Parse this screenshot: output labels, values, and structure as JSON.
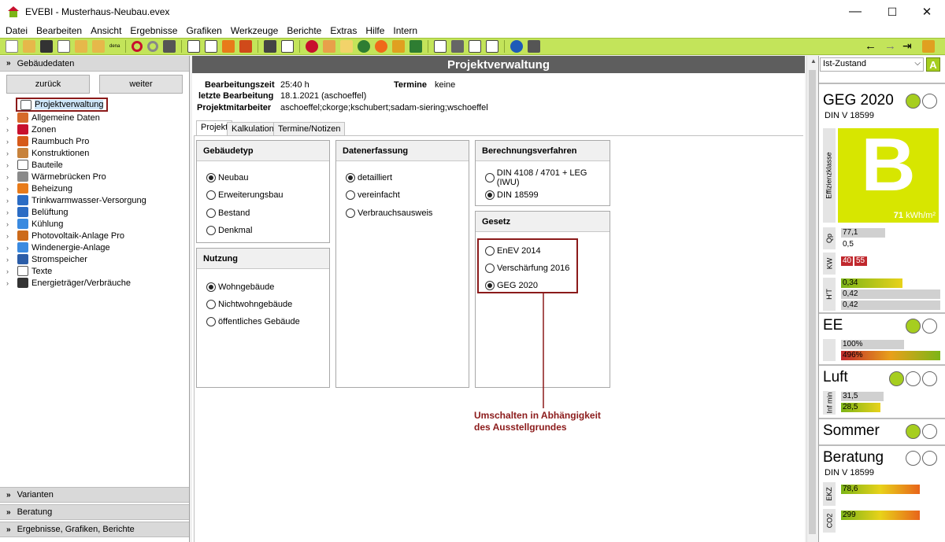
{
  "window": {
    "title": "EVEBI - Musterhaus-Neubau.evex",
    "minimize": "—",
    "maximize": "☐",
    "close": "✕"
  },
  "menu": [
    "Datei",
    "Bearbeiten",
    "Ansicht",
    "Ergebnisse",
    "Grafiken",
    "Werkzeuge",
    "Berichte",
    "Extras",
    "Hilfe",
    "Intern"
  ],
  "toolbar": {
    "dena_label": "dena",
    "icons": [
      "new-file-icon",
      "open-folder-icon",
      "save-icon",
      "copy-icon",
      "export-icon",
      "import-icon",
      "undo-icon",
      "redo-icon",
      "calculator-icon",
      "document-icon",
      "table-icon",
      "sum-icon",
      "book-icon",
      "structure-icon",
      "list-icon",
      "heating-icon",
      "wall-icon",
      "window-icon",
      "ventilation-icon",
      "sun-icon",
      "power-icon",
      "house-icon",
      "report-icon",
      "print-icon",
      "edit-icon",
      "chart-icon",
      "help-icon",
      "calculator-small-icon"
    ],
    "right_icons": [
      "back-arrow-icon",
      "forward-arrow-icon",
      "jump-icon",
      "pen-icon"
    ]
  },
  "left": {
    "header": "Gebäudedaten",
    "back": "zurück",
    "forward": "weiter",
    "tree": [
      {
        "label": "Projektverwaltung",
        "icon": "stopwatch-icon",
        "color": "#ffffff"
      },
      {
        "label": "Allgemeine Daten",
        "icon": "house-data-icon",
        "color": "#d66a2a"
      },
      {
        "label": "Zonen",
        "icon": "zones-icon",
        "color": "#c8102e"
      },
      {
        "label": "Raumbuch Pro",
        "icon": "roombook-icon",
        "color": "#d65a1a"
      },
      {
        "label": "Konstruktionen",
        "icon": "construction-icon",
        "color": "#c7823c"
      },
      {
        "label": "Bauteile",
        "icon": "building-part-icon",
        "color": "#ffffff"
      },
      {
        "label": "Wärmebrücken Pro",
        "icon": "thermal-bridge-icon",
        "color": "#8a8a8a"
      },
      {
        "label": "Beheizung",
        "icon": "heating-icon",
        "color": "#e87b1a"
      },
      {
        "label": "Trinkwarmwasser-Versorgung",
        "icon": "water-drop-icon",
        "color": "#2b6cc4"
      },
      {
        "label": "Belüftung",
        "icon": "fan-icon",
        "color": "#2b6cc4"
      },
      {
        "label": "Kühlung",
        "icon": "snowflake-icon",
        "color": "#3a8ae0"
      },
      {
        "label": "Photovoltaik-Anlage Pro",
        "icon": "solar-icon",
        "color": "#cc6a1a"
      },
      {
        "label": "Windenergie-Anlage",
        "icon": "wind-icon",
        "color": "#3a8ae0"
      },
      {
        "label": "Stromspeicher",
        "icon": "battery-icon",
        "color": "#2b5da8"
      },
      {
        "label": "Texte",
        "icon": "text-icon",
        "color": "#ffffff"
      },
      {
        "label": "Energieträger/Verbräuche",
        "icon": "plug-icon",
        "color": "#333333"
      }
    ],
    "sections": [
      "Varianten",
      "Beratung",
      "Ergebnisse, Grafiken, Berichte"
    ]
  },
  "center": {
    "title": "Projektverwaltung",
    "info": {
      "bearbeitungszeit_label": "Bearbeitungszeit",
      "bearbeitungszeit": "25:40 h",
      "termine_label": "Termine",
      "termine": "keine",
      "letzte_label": "letzte Bearbeitung",
      "letzte": "18.1.2021 (aschoeffel)",
      "mitarbeiter_label": "Projektmitarbeiter",
      "mitarbeiter": "aschoeffel;ckorge;kschubert;sadam-siering;wschoeffel"
    },
    "tabs": [
      "Projekt",
      "Kalkulation",
      "Termine/Notizen"
    ],
    "gebaeudetyp": {
      "title": "Gebäudetyp",
      "options": [
        "Neubau",
        "Erweiterungsbau",
        "Bestand",
        "Denkmal"
      ],
      "selected": 0
    },
    "nutzung": {
      "title": "Nutzung",
      "options": [
        "Wohngebäude",
        "Nichtwohngebäude",
        "öffentliches Gebäude"
      ],
      "selected": 0
    },
    "datenerfassung": {
      "title": "Datenerfassung",
      "options": [
        "detailliert",
        "vereinfacht",
        "Verbrauchsausweis"
      ],
      "selected": 0
    },
    "verfahren": {
      "title": "Berechnungsverfahren",
      "options": [
        "DIN 4108 / 4701 + LEG (IWU)",
        "DIN 18599"
      ],
      "selected": 1
    },
    "gesetz": {
      "title": "Gesetz",
      "options": [
        "EnEV 2014",
        "Verschärfung 2016",
        "GEG 2020"
      ],
      "selected": 2
    },
    "annotation_line1": "Umschalten in Abhängigkeit",
    "annotation_line2": "des Ausstellgrundes"
  },
  "right": {
    "state": "Ist-Zustand",
    "state_badge": "A",
    "geg": {
      "title": "GEG 2020",
      "norm": "DIN V 18599",
      "efficiency_label": "Effizienzklasse",
      "class": "B",
      "value": "71",
      "unit": "kWh/m²",
      "class_color": "#d7e600"
    },
    "qp": {
      "label": "Qp",
      "values": [
        "77,1",
        "0,5"
      ]
    },
    "kw": {
      "label": "KW",
      "values": [
        "40",
        "55"
      ]
    },
    "ht": {
      "label": "H'T",
      "values": [
        "0,34",
        "0,42",
        "0,42"
      ]
    },
    "ee": {
      "title": "EE",
      "values": [
        "100%",
        "496%"
      ]
    },
    "luft": {
      "title": "Luft",
      "label": "Inf min",
      "values": [
        "31,5",
        "28,5"
      ]
    },
    "sommer": {
      "title": "Sommer"
    },
    "beratung": {
      "title": "Beratung",
      "norm": "DIN V 18599",
      "ekz_label": "EKZ",
      "ekz": "78,6",
      "co2_label": "CO2",
      "co2": "299"
    }
  }
}
